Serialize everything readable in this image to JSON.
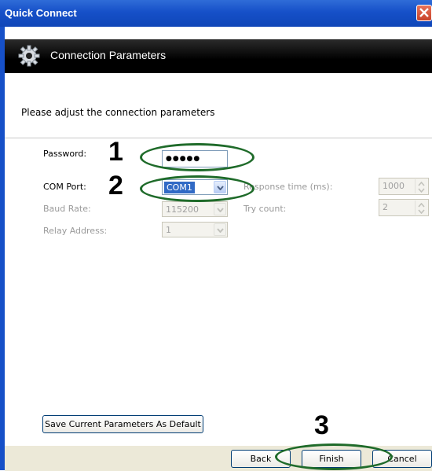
{
  "window": {
    "title": "Quick Connect"
  },
  "header": {
    "title": "Connection Parameters"
  },
  "instruction": "Please adjust the connection parameters",
  "form": {
    "password_label": "Password:",
    "password_value": "●●●●●",
    "com_port_label": "COM Port:",
    "com_port_value": "COM1",
    "baud_rate_label": "Baud Rate:",
    "baud_rate_value": "115200",
    "relay_address_label": "Relay Address:",
    "relay_address_value": "1",
    "response_time_label": "Response time (ms):",
    "response_time_value": "1000",
    "try_count_label": "Try count:",
    "try_count_value": "2"
  },
  "buttons": {
    "save_default": "Save Current Parameters As Default",
    "back": "Back",
    "finish": "Finish",
    "cancel": "Cancel"
  },
  "annotations": {
    "n1": "1",
    "n2": "2",
    "n3": "3",
    "color": "#1f6b2a"
  },
  "icons": {
    "header": "gear-icon",
    "close": "close-icon"
  }
}
